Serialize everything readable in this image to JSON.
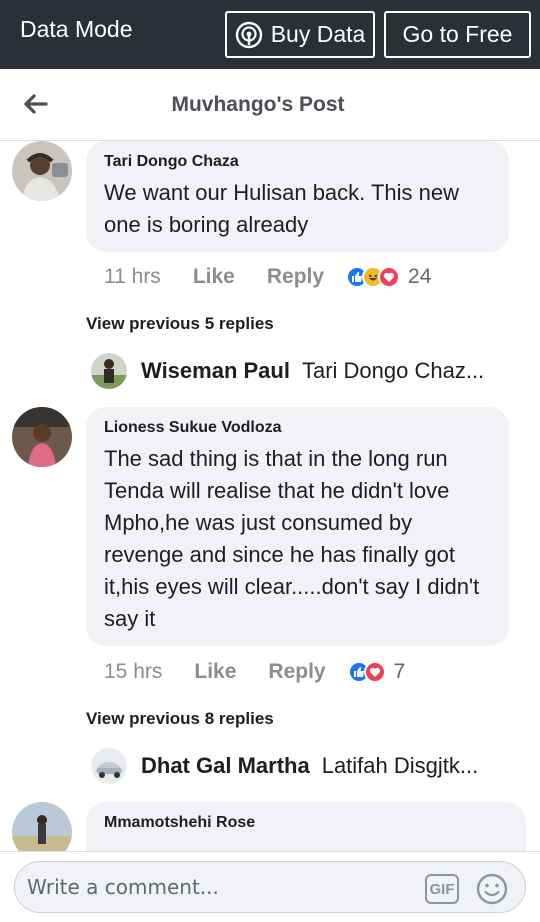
{
  "datamode": {
    "title": "Data Mode",
    "buy_label": "Buy Data",
    "free_label": "Go to Free"
  },
  "header": {
    "title": "Muvhango's Post"
  },
  "comments": [
    {
      "author": "Tari Dongo Chaza",
      "text": "We want our Hulisan back. This new one is boring already",
      "time": "11 hrs",
      "like": "Like",
      "reply": "Reply",
      "reaction_count": "24",
      "reactions": [
        "like",
        "haha",
        "love"
      ],
      "view_previous": "View previous 5 replies",
      "latest_reply": {
        "author": "Wiseman Paul",
        "text": "Tari Dongo Chaz..."
      }
    },
    {
      "author": "Lioness Sukue Vodloza",
      "text": "The sad thing is that in the long run Tenda will realise that he didn't love Mpho,he was just consumed by revenge and since he has finally got it,his eyes will clear.....don't say I didn't say it",
      "time": "15 hrs",
      "like": "Like",
      "reply": "Reply",
      "reaction_count": "7",
      "reactions": [
        "like",
        "love"
      ],
      "view_previous": "View previous 8 replies",
      "latest_reply": {
        "author": "Dhat Gal Martha",
        "text": "Latifah Disgjtk..."
      }
    },
    {
      "author": "Mmamotshehi Rose",
      "text": ""
    }
  ],
  "composer": {
    "placeholder": "Write a comment...",
    "gif_label": "GIF"
  },
  "icons": {
    "back": "back-arrow-icon",
    "broadcast": "broadcast-icon",
    "emoji": "emoji-icon"
  },
  "colors": {
    "topbar": "#2b2f36",
    "like_blue": "#1877f2",
    "love_red": "#f33e58",
    "haha_yellow": "#f7b928",
    "bubble": "#f0f2f5"
  }
}
